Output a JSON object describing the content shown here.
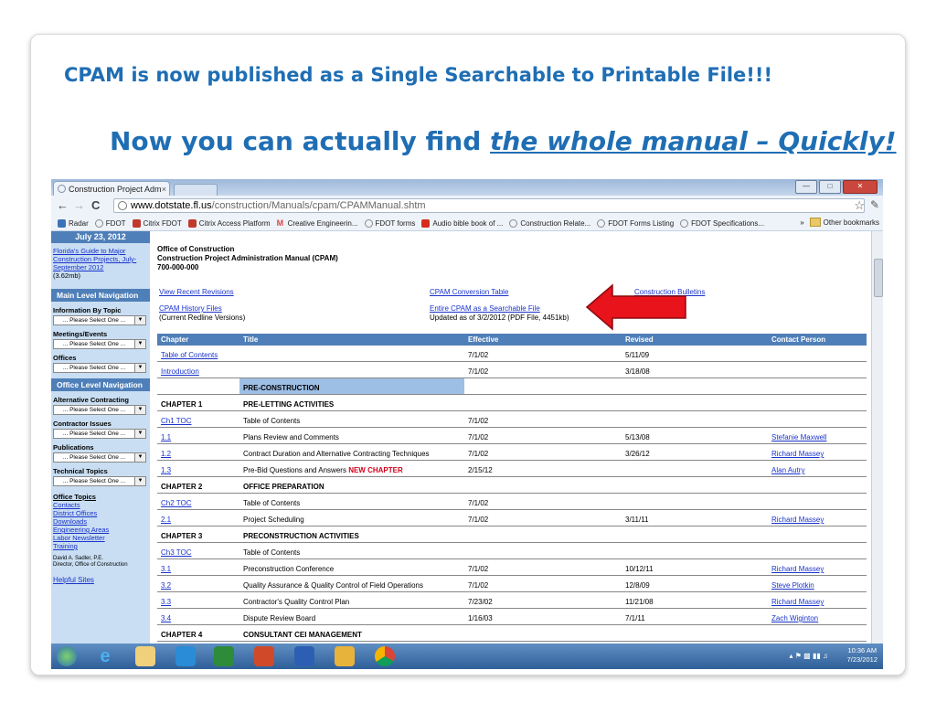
{
  "slide": {
    "title1": "CPAM is now published as a Single Searchable to Printable File!!!",
    "title2_prefix": "Now you can actually find ",
    "title2_emph": "the whole manual – Quickly!"
  },
  "browser": {
    "tab_title": "Construction Project Adm",
    "tab_close": "×",
    "url_host": "www.dotstate.fl.us",
    "url_path": "/construction/Manuals/cpam/CPAMManual.shtm",
    "bookmarks": [
      "Radar",
      "FDOT",
      "Citrix FDOT",
      "Citrix Access Platform",
      "Creative Engineerin...",
      "FDOT forms",
      "Audio bible book of ...",
      "Construction Relate...",
      "FDOT Forms Listing",
      "FDOT Specifications..."
    ],
    "other_bookmarks": "Other bookmarks",
    "overflow": "»"
  },
  "sidebar": {
    "date": "July 23, 2012",
    "guide_link": "Florida's Guide to Major Construction Projects, July-September 2012",
    "guide_size": "(3.62mb)",
    "main_nav": "Main Level Navigation",
    "info_topic": "Information By Topic",
    "meetings": "Meetings/Events",
    "offices": "Offices",
    "office_nav": "Office Level Navigation",
    "alt_contracting": "Alternative Contracting",
    "contractor_issues": "Contractor Issues",
    "publications": "Publications",
    "technical_topics": "Technical Topics",
    "select_placeholder": "... Please Select One ...",
    "office_topics": "Office Topics",
    "office_links": [
      "Contacts",
      "District Offices",
      "Downloads",
      "Engineering Areas",
      "Labor Newsletter",
      "Training"
    ],
    "director_name": "David A. Sadler, P.E.",
    "director_title": "Director, Office of Construction",
    "helpful": "Helpful Sites"
  },
  "main": {
    "office1": "Office of Construction",
    "office2": "Construction Project Administration Manual (CPAM)",
    "office3": "700-000-000",
    "recent_revisions": "View Recent Revisions",
    "conversion_table": "CPAM Conversion Table",
    "bulletins": "Construction Bulletins",
    "history_files": "CPAM History Files",
    "history_note": "(Current Redline Versions)",
    "searchable_file": "Entire CPAM as a Searchable File",
    "searchable_note": "Updated as of 3/2/2012 (PDF File, 4451kb)",
    "columns": [
      "Chapter",
      "Title",
      "Effective",
      "Revised",
      "Contact Person"
    ],
    "rows": [
      {
        "chapter": "Table of Contents",
        "chapter_link": true,
        "title": "",
        "effective": "7/1/02",
        "revised": "5/11/09",
        "contact": ""
      },
      {
        "chapter": "Introduction",
        "chapter_link": true,
        "title": "",
        "effective": "7/1/02",
        "revised": "3/18/08",
        "contact": ""
      },
      {
        "chapter": "",
        "chapter_link": false,
        "title": "PRE-CONSTRUCTION",
        "section": true,
        "effective": "",
        "revised": "",
        "contact": ""
      },
      {
        "chapter": "CHAPTER 1",
        "chapter_bold": true,
        "title": "PRE-LETTING ACTIVITIES",
        "title_bold": true,
        "effective": "",
        "revised": "",
        "contact": ""
      },
      {
        "chapter": "Ch1 TOC",
        "chapter_link": true,
        "title": "Table of Contents",
        "effective": "7/1/02",
        "revised": "",
        "contact": ""
      },
      {
        "chapter": "1.1",
        "chapter_link": true,
        "title": "Plans Review and Comments",
        "effective": "7/1/02",
        "revised": "5/13/08",
        "contact": "Stefanie Maxwell"
      },
      {
        "chapter": "1.2",
        "chapter_link": true,
        "title": "Contract Duration and Alternative Contracting Techniques",
        "effective": "7/1/02",
        "revised": "3/26/12",
        "contact": "Richard Massey"
      },
      {
        "chapter": "1.3",
        "chapter_link": true,
        "title": "Pre-Bid Questions and Answers",
        "badge": "NEW CHAPTER",
        "effective": "2/15/12",
        "revised": "",
        "contact": "Alan Autry"
      },
      {
        "chapter": "CHAPTER 2",
        "chapter_bold": true,
        "title": "OFFICE PREPARATION",
        "title_bold": true,
        "effective": "",
        "revised": "",
        "contact": ""
      },
      {
        "chapter": "Ch2 TOC",
        "chapter_link": true,
        "title": "Table of Contents",
        "effective": "7/1/02",
        "revised": "",
        "contact": ""
      },
      {
        "chapter": "2.1",
        "chapter_link": true,
        "title": "Project Scheduling",
        "effective": "7/1/02",
        "revised": "3/11/11",
        "contact": "Richard Massey"
      },
      {
        "chapter": "CHAPTER 3",
        "chapter_bold": true,
        "title": "PRECONSTRUCTION ACTIVITIES",
        "title_bold": true,
        "effective": "",
        "revised": "",
        "contact": ""
      },
      {
        "chapter": "Ch3 TOC",
        "chapter_link": true,
        "title": "Table of Contents",
        "effective": "",
        "revised": "",
        "contact": ""
      },
      {
        "chapter": "3.1",
        "chapter_link": true,
        "title": "Preconstruction Conference",
        "effective": "7/1/02",
        "revised": "10/12/11",
        "contact": "Richard Massey"
      },
      {
        "chapter": "3.2",
        "chapter_link": true,
        "title": "Quality Assurance & Quality Control of Field Operations",
        "effective": "7/1/02",
        "revised": "12/8/09",
        "contact": "Steve Plotkin"
      },
      {
        "chapter": "3.3",
        "chapter_link": true,
        "title": "Contractor's Quality Control Plan",
        "effective": "7/23/02",
        "revised": "11/21/08",
        "contact": "Richard Massey"
      },
      {
        "chapter": "3.4",
        "chapter_link": true,
        "title": "Dispute Review Board",
        "effective": "1/16/03",
        "revised": "7/1/11",
        "contact": "Zach Wiginton"
      },
      {
        "chapter": "CHAPTER 4",
        "chapter_bold": true,
        "title": "CONSULTANT CEI MANAGEMENT",
        "title_bold": true,
        "effective": "",
        "revised": "",
        "contact": ""
      }
    ]
  },
  "taskbar": {
    "time": "10:36 AM",
    "date": "7/23/2012"
  },
  "colors": {
    "slide_title": "#1f6eb4",
    "header_blue": "#4f7fb8",
    "sidebar_bg": "#c9def2",
    "link": "#1a33cc",
    "new_chapter": "#d0021b",
    "arrow": "#e8131b"
  }
}
